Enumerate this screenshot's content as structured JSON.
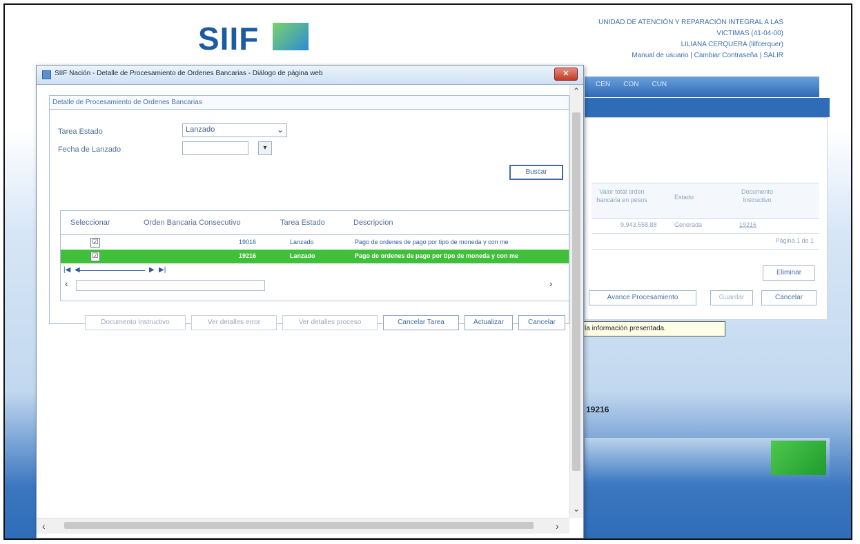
{
  "background": {
    "logo_text": "SIIF",
    "info": {
      "line1": "UNIDAD DE ATENCIÓN Y REPARACIÓN INTEGRAL A LAS",
      "line2": "VICTIMAS (41-04-00)",
      "user": "LILIANA CERQUERA (lilfcerquer)",
      "links": "Manual de usuario | Cambiar Contraseña | SALIR"
    },
    "menu": [
      "CEN",
      "CON",
      "CUN"
    ],
    "table_headers": {
      "valor": "Valor total orden bancaria en pesos",
      "estado": "Estado",
      "documento": "Documento Instructivo"
    },
    "row": {
      "valor": "9.943.558,88",
      "estado": "Generada",
      "documento": "19216"
    },
    "pager": "Página 1 de 1",
    "buttons": {
      "eliminar": "Eliminar",
      "avance": "Avance Procesamiento",
      "guardar": "Guardar",
      "cancelar": "Cancelar"
    },
    "bottom_number": "19216"
  },
  "tooltip": "Hacer clic para actualizar la información presentada.",
  "dialog": {
    "title": "SIIF Nación - Detalle de Procesamiento de Ordenes Bancarias - Diálogo de página web",
    "close_label": "✕",
    "panel_title": "Detalle de Procesamiento de Ordenes Bancarias",
    "form": {
      "tarea_estado_label": "Tarea Estado",
      "tarea_estado_value": "Lanzado",
      "fecha_label": "Fecha de Lanzado",
      "fecha_value": "",
      "buscar": "Buscar"
    },
    "grid": {
      "headers": [
        "Seleccionar",
        "Orden Bancaria Consecutivo",
        "Tarea Estado",
        "Descripcion"
      ],
      "rows": [
        {
          "checked": "☑",
          "consecutivo": "19016",
          "estado": "Lanzado",
          "descripcion": "Pago de ordenes de pago por tipo de moneda y con me",
          "selected": false
        },
        {
          "checked": "☑",
          "consecutivo": "19216",
          "estado": "Lanzado",
          "descripcion": "Pago de ordenes de pago por tipo de moneda y con me",
          "selected": true
        }
      ],
      "pager_first": "|◀",
      "pager_prev": "◀",
      "pager_next": "▶",
      "pager_last": "▶|"
    },
    "buttons": {
      "documento": "Documento Instructivo",
      "ver_error": "Ver detalles error",
      "ver_proceso": "Ver detalles proceso",
      "cancelar_tarea": "Cancelar Tarea",
      "actualizar": "Actualizar",
      "cancelar": "Cancelar"
    }
  }
}
